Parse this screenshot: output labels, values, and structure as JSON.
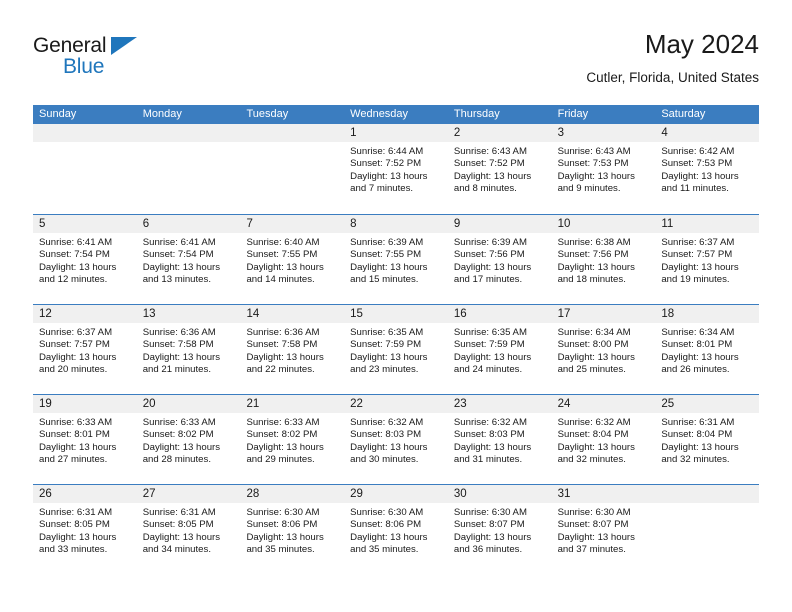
{
  "brand": {
    "name_part1": "General",
    "name_part2": "Blue",
    "logo_icon": "triangle-icon"
  },
  "header": {
    "title": "May 2024",
    "subtitle": "Cutler, Florida, United States"
  },
  "colors": {
    "header_blue": "#3b7dc0",
    "brand_blue": "#1f76bc",
    "day_band": "#f0f0f0",
    "text": "#1a1a1a"
  },
  "weekdays": [
    "Sunday",
    "Monday",
    "Tuesday",
    "Wednesday",
    "Thursday",
    "Friday",
    "Saturday"
  ],
  "labels": {
    "sunrise_prefix": "Sunrise:",
    "sunset_prefix": "Sunset:",
    "daylight_prefix": "Daylight:"
  },
  "weeks": [
    [
      {
        "day": "",
        "sunrise": "",
        "sunset": "",
        "daylight": ""
      },
      {
        "day": "",
        "sunrise": "",
        "sunset": "",
        "daylight": ""
      },
      {
        "day": "",
        "sunrise": "",
        "sunset": "",
        "daylight": ""
      },
      {
        "day": "1",
        "sunrise": "Sunrise: 6:44 AM",
        "sunset": "Sunset: 7:52 PM",
        "daylight": "Daylight: 13 hours and 7 minutes."
      },
      {
        "day": "2",
        "sunrise": "Sunrise: 6:43 AM",
        "sunset": "Sunset: 7:52 PM",
        "daylight": "Daylight: 13 hours and 8 minutes."
      },
      {
        "day": "3",
        "sunrise": "Sunrise: 6:43 AM",
        "sunset": "Sunset: 7:53 PM",
        "daylight": "Daylight: 13 hours and 9 minutes."
      },
      {
        "day": "4",
        "sunrise": "Sunrise: 6:42 AM",
        "sunset": "Sunset: 7:53 PM",
        "daylight": "Daylight: 13 hours and 11 minutes."
      }
    ],
    [
      {
        "day": "5",
        "sunrise": "Sunrise: 6:41 AM",
        "sunset": "Sunset: 7:54 PM",
        "daylight": "Daylight: 13 hours and 12 minutes."
      },
      {
        "day": "6",
        "sunrise": "Sunrise: 6:41 AM",
        "sunset": "Sunset: 7:54 PM",
        "daylight": "Daylight: 13 hours and 13 minutes."
      },
      {
        "day": "7",
        "sunrise": "Sunrise: 6:40 AM",
        "sunset": "Sunset: 7:55 PM",
        "daylight": "Daylight: 13 hours and 14 minutes."
      },
      {
        "day": "8",
        "sunrise": "Sunrise: 6:39 AM",
        "sunset": "Sunset: 7:55 PM",
        "daylight": "Daylight: 13 hours and 15 minutes."
      },
      {
        "day": "9",
        "sunrise": "Sunrise: 6:39 AM",
        "sunset": "Sunset: 7:56 PM",
        "daylight": "Daylight: 13 hours and 17 minutes."
      },
      {
        "day": "10",
        "sunrise": "Sunrise: 6:38 AM",
        "sunset": "Sunset: 7:56 PM",
        "daylight": "Daylight: 13 hours and 18 minutes."
      },
      {
        "day": "11",
        "sunrise": "Sunrise: 6:37 AM",
        "sunset": "Sunset: 7:57 PM",
        "daylight": "Daylight: 13 hours and 19 minutes."
      }
    ],
    [
      {
        "day": "12",
        "sunrise": "Sunrise: 6:37 AM",
        "sunset": "Sunset: 7:57 PM",
        "daylight": "Daylight: 13 hours and 20 minutes."
      },
      {
        "day": "13",
        "sunrise": "Sunrise: 6:36 AM",
        "sunset": "Sunset: 7:58 PM",
        "daylight": "Daylight: 13 hours and 21 minutes."
      },
      {
        "day": "14",
        "sunrise": "Sunrise: 6:36 AM",
        "sunset": "Sunset: 7:58 PM",
        "daylight": "Daylight: 13 hours and 22 minutes."
      },
      {
        "day": "15",
        "sunrise": "Sunrise: 6:35 AM",
        "sunset": "Sunset: 7:59 PM",
        "daylight": "Daylight: 13 hours and 23 minutes."
      },
      {
        "day": "16",
        "sunrise": "Sunrise: 6:35 AM",
        "sunset": "Sunset: 7:59 PM",
        "daylight": "Daylight: 13 hours and 24 minutes."
      },
      {
        "day": "17",
        "sunrise": "Sunrise: 6:34 AM",
        "sunset": "Sunset: 8:00 PM",
        "daylight": "Daylight: 13 hours and 25 minutes."
      },
      {
        "day": "18",
        "sunrise": "Sunrise: 6:34 AM",
        "sunset": "Sunset: 8:01 PM",
        "daylight": "Daylight: 13 hours and 26 minutes."
      }
    ],
    [
      {
        "day": "19",
        "sunrise": "Sunrise: 6:33 AM",
        "sunset": "Sunset: 8:01 PM",
        "daylight": "Daylight: 13 hours and 27 minutes."
      },
      {
        "day": "20",
        "sunrise": "Sunrise: 6:33 AM",
        "sunset": "Sunset: 8:02 PM",
        "daylight": "Daylight: 13 hours and 28 minutes."
      },
      {
        "day": "21",
        "sunrise": "Sunrise: 6:33 AM",
        "sunset": "Sunset: 8:02 PM",
        "daylight": "Daylight: 13 hours and 29 minutes."
      },
      {
        "day": "22",
        "sunrise": "Sunrise: 6:32 AM",
        "sunset": "Sunset: 8:03 PM",
        "daylight": "Daylight: 13 hours and 30 minutes."
      },
      {
        "day": "23",
        "sunrise": "Sunrise: 6:32 AM",
        "sunset": "Sunset: 8:03 PM",
        "daylight": "Daylight: 13 hours and 31 minutes."
      },
      {
        "day": "24",
        "sunrise": "Sunrise: 6:32 AM",
        "sunset": "Sunset: 8:04 PM",
        "daylight": "Daylight: 13 hours and 32 minutes."
      },
      {
        "day": "25",
        "sunrise": "Sunrise: 6:31 AM",
        "sunset": "Sunset: 8:04 PM",
        "daylight": "Daylight: 13 hours and 32 minutes."
      }
    ],
    [
      {
        "day": "26",
        "sunrise": "Sunrise: 6:31 AM",
        "sunset": "Sunset: 8:05 PM",
        "daylight": "Daylight: 13 hours and 33 minutes."
      },
      {
        "day": "27",
        "sunrise": "Sunrise: 6:31 AM",
        "sunset": "Sunset: 8:05 PM",
        "daylight": "Daylight: 13 hours and 34 minutes."
      },
      {
        "day": "28",
        "sunrise": "Sunrise: 6:30 AM",
        "sunset": "Sunset: 8:06 PM",
        "daylight": "Daylight: 13 hours and 35 minutes."
      },
      {
        "day": "29",
        "sunrise": "Sunrise: 6:30 AM",
        "sunset": "Sunset: 8:06 PM",
        "daylight": "Daylight: 13 hours and 35 minutes."
      },
      {
        "day": "30",
        "sunrise": "Sunrise: 6:30 AM",
        "sunset": "Sunset: 8:07 PM",
        "daylight": "Daylight: 13 hours and 36 minutes."
      },
      {
        "day": "31",
        "sunrise": "Sunrise: 6:30 AM",
        "sunset": "Sunset: 8:07 PM",
        "daylight": "Daylight: 13 hours and 37 minutes."
      },
      {
        "day": "",
        "sunrise": "",
        "sunset": "",
        "daylight": ""
      }
    ]
  ]
}
